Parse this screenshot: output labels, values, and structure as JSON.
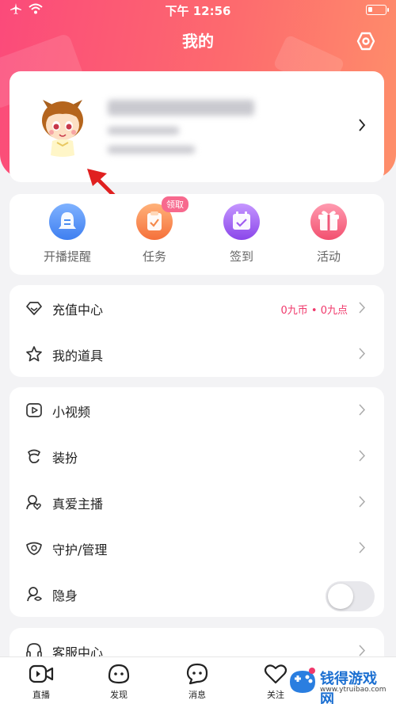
{
  "status_bar": {
    "time": "下午 12:56"
  },
  "header": {
    "title": "我的"
  },
  "quick_actions": [
    {
      "label": "开播提醒",
      "icon": "bell-icon",
      "color": "#4a8cf0"
    },
    {
      "label": "任务",
      "icon": "task-clipboard-icon",
      "color": "#f5884a",
      "badge": "领取"
    },
    {
      "label": "签到",
      "icon": "calendar-check-icon",
      "color": "#a05cf0"
    },
    {
      "label": "活动",
      "icon": "gift-icon",
      "color": "#f0587a"
    }
  ],
  "menu_group_1": [
    {
      "label": "充值中心",
      "value": "0九币 • 0九点",
      "icon": "diamond-icon"
    },
    {
      "label": "我的道具",
      "icon": "star-icon"
    }
  ],
  "menu_group_2": [
    {
      "label": "小视频",
      "icon": "video-play-icon"
    },
    {
      "label": "装扮",
      "icon": "brush-icon"
    },
    {
      "label": "真爱主播",
      "icon": "heart-person-icon"
    },
    {
      "label": "守护/管理",
      "icon": "shield-eye-icon"
    },
    {
      "label": "隐身",
      "icon": "hide-person-icon",
      "toggle_on": false
    }
  ],
  "menu_group_3": [
    {
      "label": "客服中心",
      "icon": "headset-icon"
    }
  ],
  "tabbar": [
    {
      "label": "直播",
      "icon": "live-camera-icon"
    },
    {
      "label": "发现",
      "icon": "discover-icon"
    },
    {
      "label": "消息",
      "icon": "message-icon"
    },
    {
      "label": "关注",
      "icon": "heart-icon"
    }
  ],
  "watermark": {
    "title": "钱得游戏网",
    "url": "www.ytruibao.com"
  }
}
